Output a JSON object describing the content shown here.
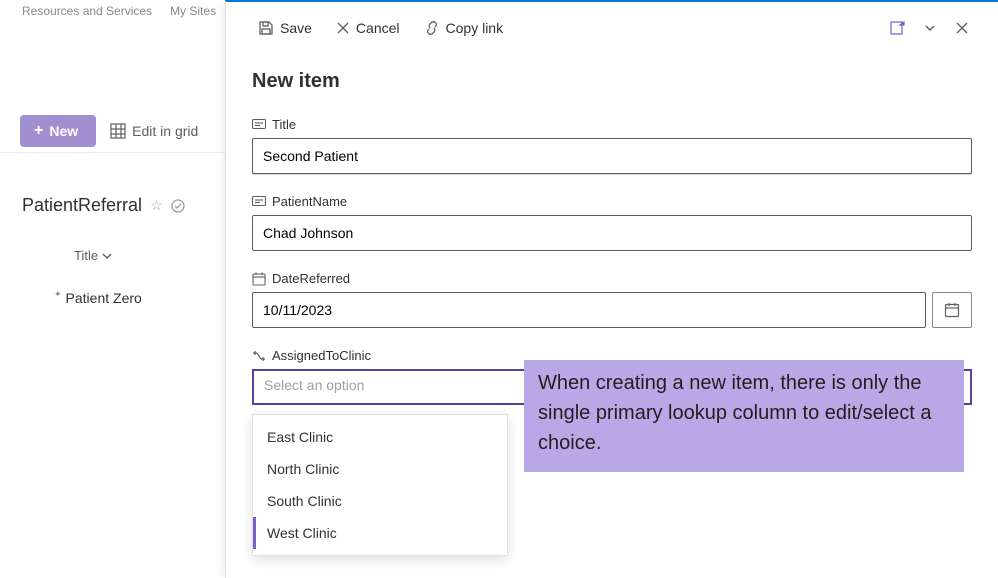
{
  "topnav": {
    "resources": "Resources and Services",
    "mysites": "My Sites"
  },
  "cmdbar": {
    "new_label": "New",
    "edit_grid_label": "Edit in grid"
  },
  "list": {
    "name": "PatientReferral",
    "column_title": "Title",
    "row0_title": "Patient Zero"
  },
  "panel": {
    "cmd_save": "Save",
    "cmd_cancel": "Cancel",
    "cmd_copy": "Copy link",
    "heading": "New item",
    "fields": {
      "title_label": "Title",
      "title_value": "Second Patient",
      "patient_label": "PatientName",
      "patient_value": "Chad Johnson",
      "date_label": "DateReferred",
      "date_value": "10/11/2023",
      "clinic_label": "AssignedToClinic",
      "clinic_placeholder": "Select an option"
    },
    "dropdown": {
      "opt0": "East Clinic",
      "opt1": "North Clinic",
      "opt2": "South Clinic",
      "opt3": "West Clinic"
    }
  },
  "callout": {
    "text": "When creating a new item, there is only the single primary lookup column to edit/select a choice."
  }
}
